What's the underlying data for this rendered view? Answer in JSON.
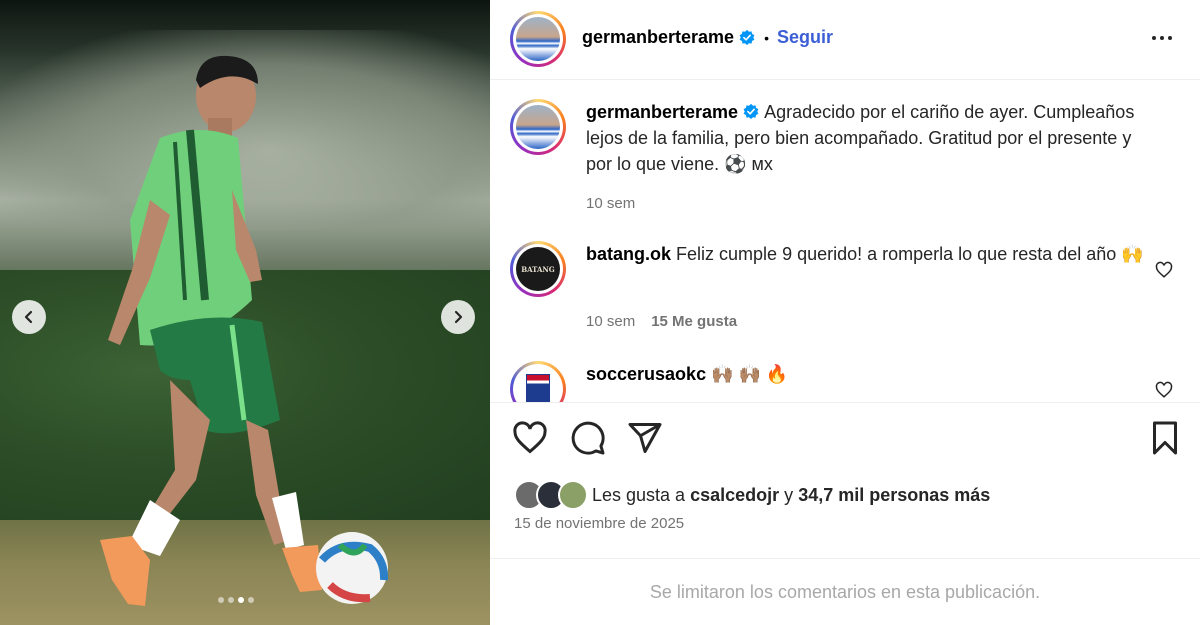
{
  "post": {
    "author": "germanberterame",
    "follow_label": "Seguir",
    "separator": "•",
    "caption": "Agradecido por el cariño de ayer. Cumpleaños lejos de la familia, pero bien acompañado. Gratitud por el presente y por lo que viene. ⚽  мх",
    "caption_time": "10 sem",
    "carousel": {
      "total": 4,
      "active_index": 2
    }
  },
  "comments": [
    {
      "user": "batang.ok",
      "text": "Feliz cumple 9 querido! a romperla lo que resta del año 🙌",
      "time": "10 sem",
      "likes": "15 Me gusta",
      "avatar_text": "BATANG"
    },
    {
      "user": "soccerusaokc",
      "text": "🙌🏽 🙌🏽 🔥"
    }
  ],
  "likes": {
    "prefix": "Les gusta a",
    "user": "csalcedojr",
    "connector": "y",
    "others": "34,7 mil personas más"
  },
  "date": "15 de noviembre de 2025",
  "footer_notice": "Se limitaron los comentarios en esta publicación.",
  "icons": [
    "chevron-left-icon",
    "chevron-right-icon",
    "verified-icon",
    "more-icon",
    "heart-icon",
    "comment-icon",
    "share-icon",
    "bookmark-icon"
  ],
  "colors": {
    "link": "#3d5fd6",
    "verified": "#0095f6",
    "meta": "#737373",
    "footer": "#a8a8a8"
  }
}
